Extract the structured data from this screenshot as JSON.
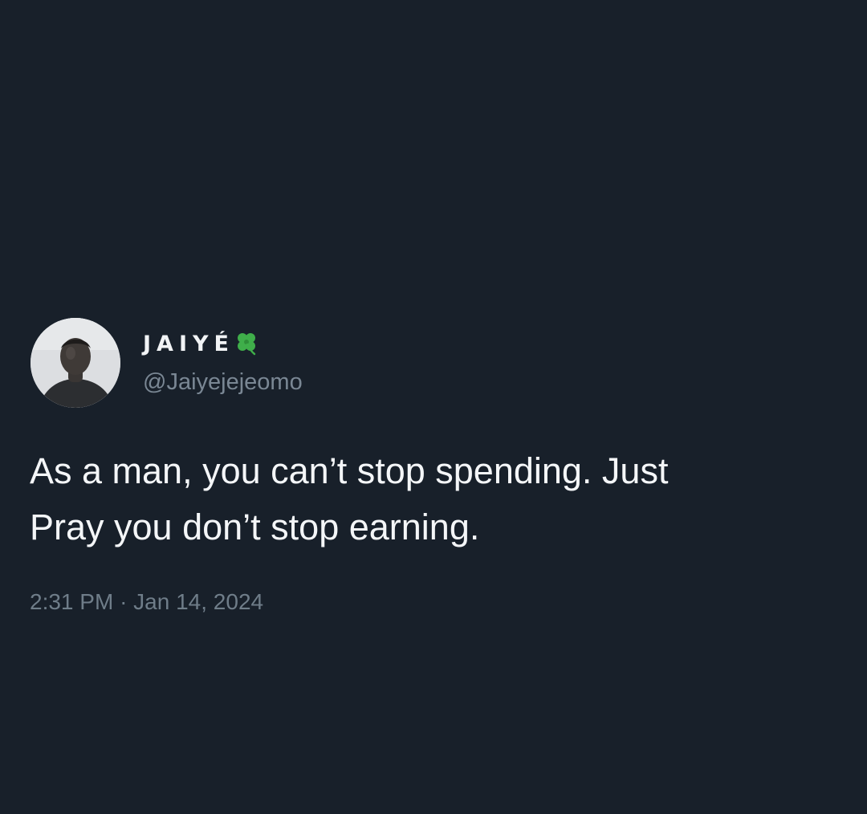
{
  "tweet": {
    "display_name": "JAIYÉ",
    "name_emoji_icon": "four-leaf-clover-icon",
    "handle": "@Jaiyejejeomo",
    "text_line1": "As a man, you can’t stop spending. Just",
    "text_line2": "Pray you don’t stop earning.",
    "time": "2:31 PM",
    "separator": "·",
    "date": "Jan 14, 2024"
  },
  "colors": {
    "background": "#18202a",
    "text": "#f4f6f8",
    "muted": "#7a8794",
    "clover": "#3fae4a"
  }
}
